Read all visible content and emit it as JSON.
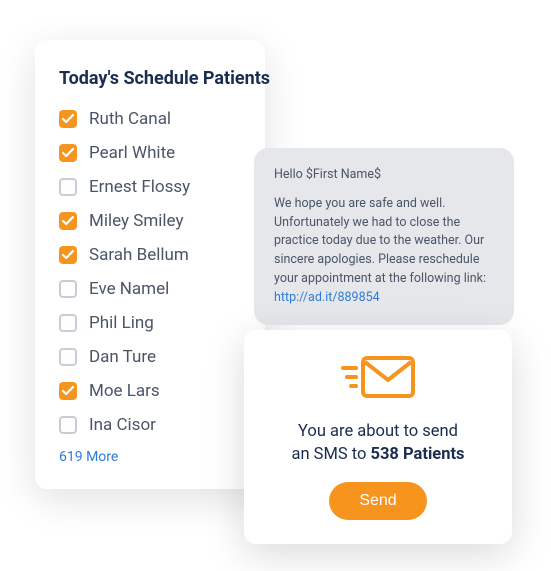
{
  "schedule": {
    "title": "Today's Schedule Patients",
    "patients": [
      {
        "name": "Ruth Canal",
        "checked": true
      },
      {
        "name": "Pearl White",
        "checked": true
      },
      {
        "name": "Ernest Flossy",
        "checked": false
      },
      {
        "name": "Miley Smiley",
        "checked": true
      },
      {
        "name": "Sarah Bellum",
        "checked": true
      },
      {
        "name": "Eve Namel",
        "checked": false
      },
      {
        "name": "Phil Ling",
        "checked": false
      },
      {
        "name": "Dan Ture",
        "checked": false
      },
      {
        "name": "Moe Lars",
        "checked": true
      },
      {
        "name": "Ina Cisor",
        "checked": false
      }
    ],
    "more": "619 More"
  },
  "message": {
    "greeting": "Hello $First Name$",
    "body": "We hope you are safe and well. Unfortunately we had to close the practice today due to the weather. Our sincere apologies. Please reschedule your appointment at the following link: ",
    "link": "http://ad.it/889854"
  },
  "send_panel": {
    "line1": "You are about to send",
    "line2_pre": "an SMS to ",
    "count": "538 Patients",
    "button": "Send"
  },
  "colors": {
    "accent": "#f7941e",
    "link": "#2e7cd6"
  }
}
